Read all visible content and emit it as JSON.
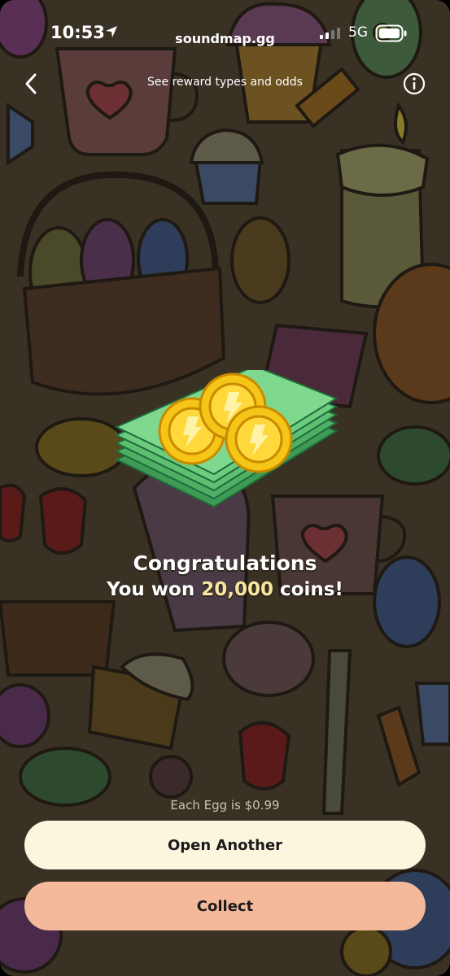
{
  "status_bar": {
    "time": "10:53",
    "site": "soundmap.gg",
    "network": "5G"
  },
  "header": {
    "reward_link": "See reward types and odds"
  },
  "result": {
    "title": "Congratulations",
    "prefix": "You won ",
    "amount": "20,000",
    "suffix": " coins!"
  },
  "footer": {
    "price_note": "Each Egg is $0.99",
    "open_another_label": "Open Another",
    "collect_label": "Collect"
  },
  "colors": {
    "background": "#3a3125",
    "open_button": "#fdf6df",
    "collect_button": "#f4b89a",
    "amount_highlight": "#f7e7a0"
  },
  "icons": {
    "back": "chevron-left-icon",
    "info": "info-icon",
    "location": "location-arrow-icon",
    "signal": "signal-icon",
    "battery": "battery-icon",
    "prize": "money-coins-icon"
  }
}
